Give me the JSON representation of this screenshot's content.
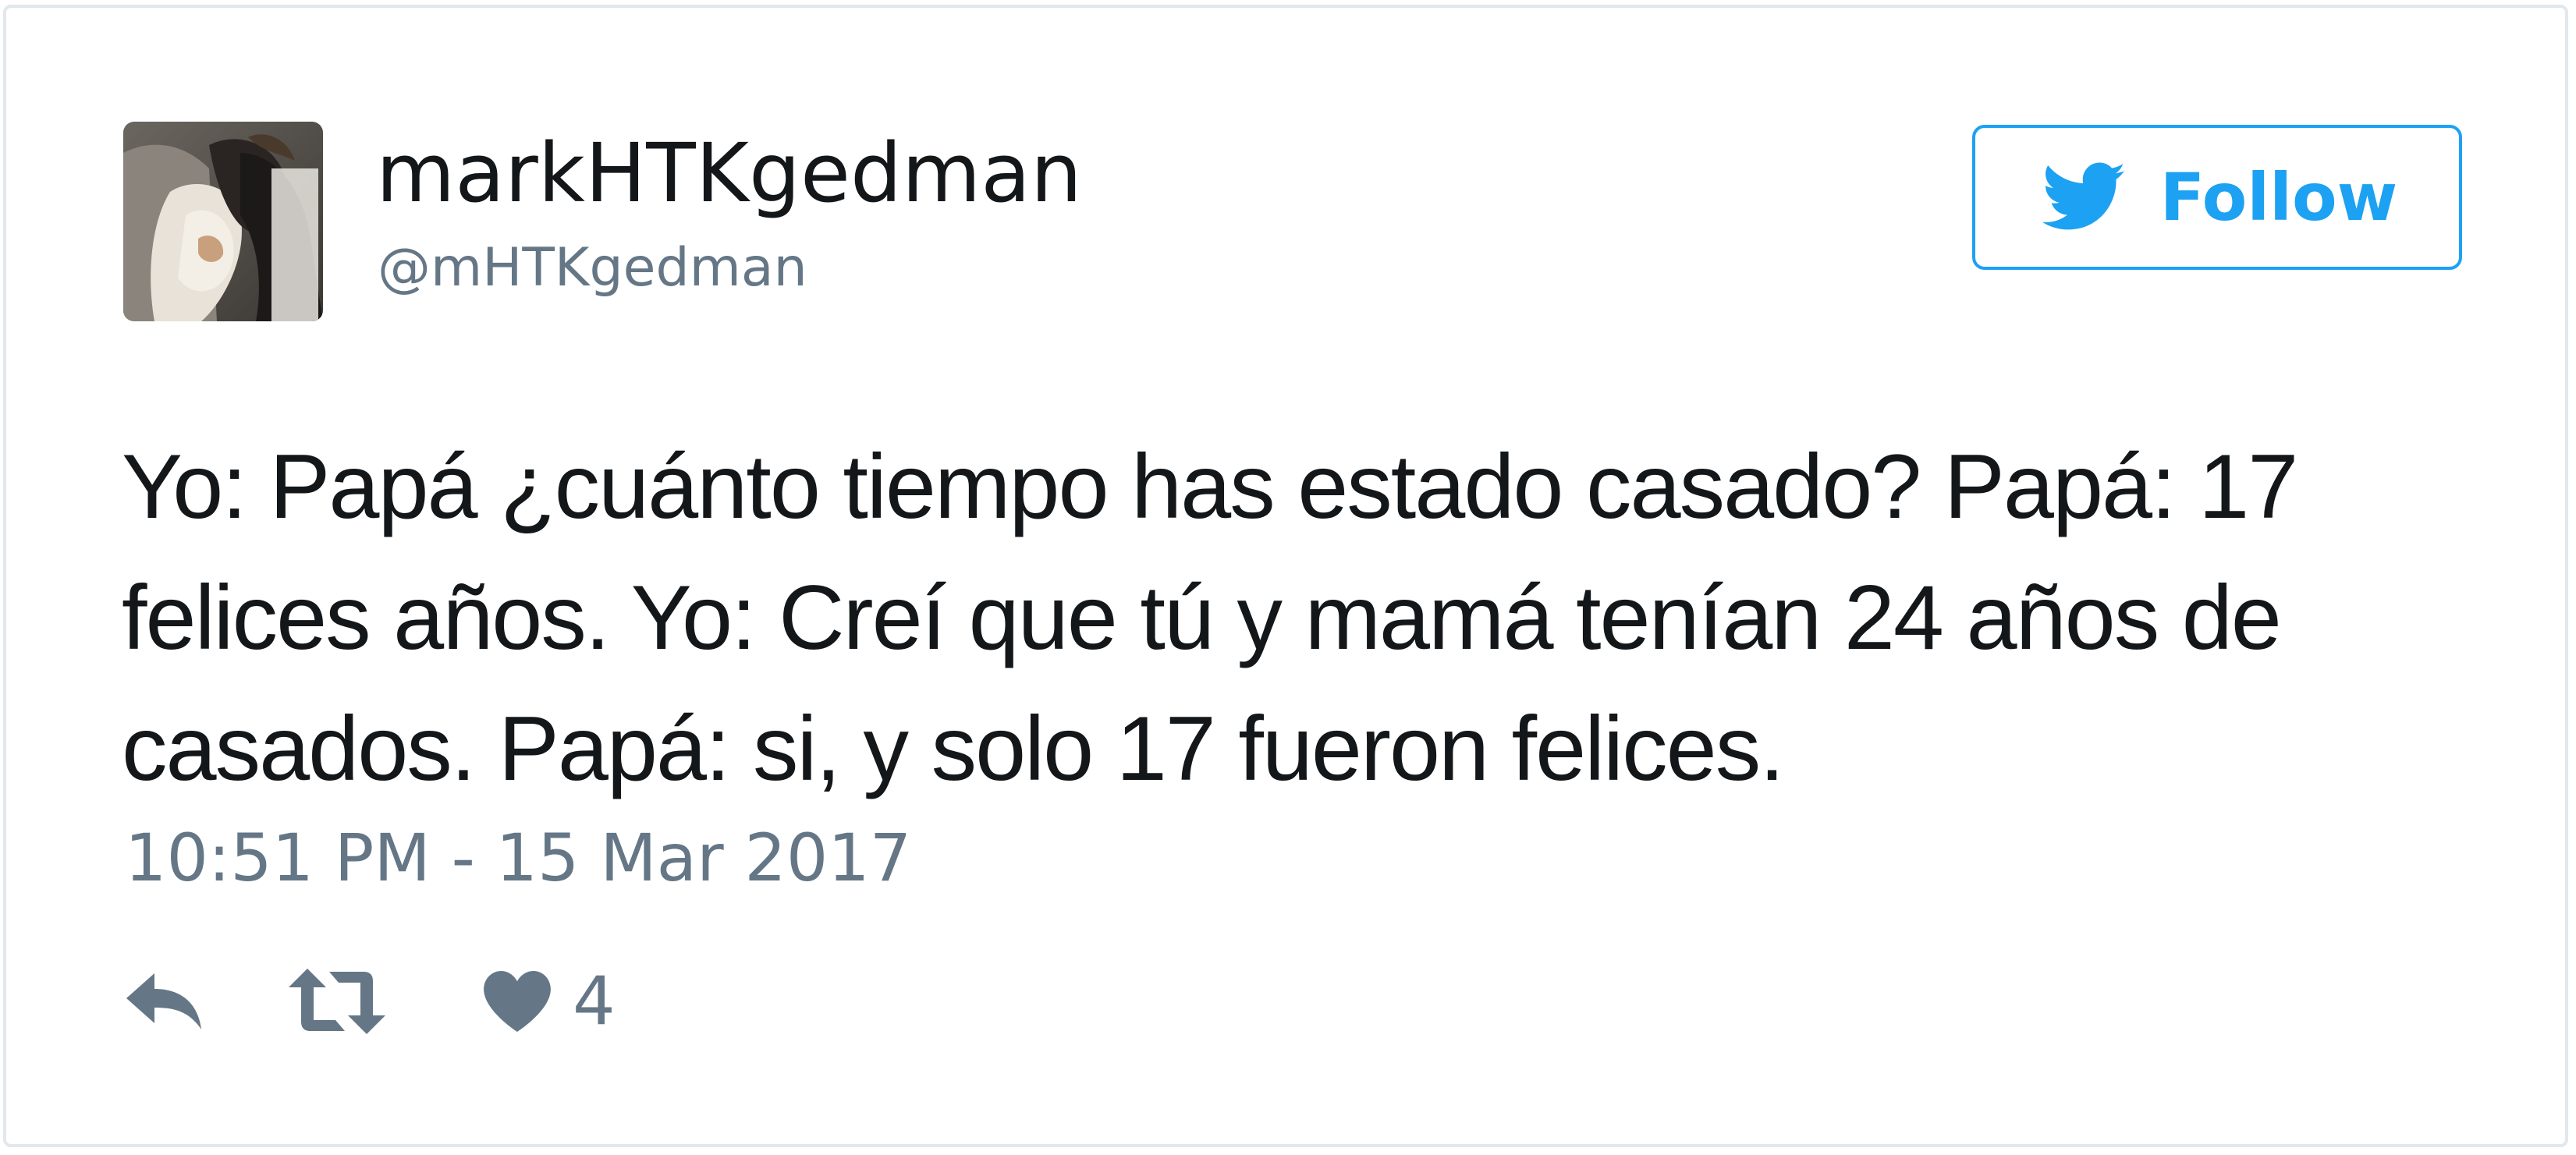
{
  "user": {
    "display_name": "markHTKgedman",
    "handle": "@mHTKgedman"
  },
  "follow_button": {
    "label": "Follow",
    "icon": "twitter-bird-icon"
  },
  "tweet": {
    "text": "Yo: Papá ¿cuánto tiempo has estado casado? Papá: 17 felices años. Yo: Creí que tú y mamá tenían 24 años de casados. Papá: si, y solo 17 fueron felices.",
    "timestamp": "10:51 PM - 15 Mar 2017"
  },
  "actions": {
    "reply_icon": "reply-icon",
    "retweet_icon": "retweet-icon",
    "like_icon": "heart-icon",
    "like_count": "4"
  },
  "colors": {
    "accent": "#1da1f2",
    "text": "#14171a",
    "muted": "#657786",
    "border": "#e1e8ed"
  }
}
